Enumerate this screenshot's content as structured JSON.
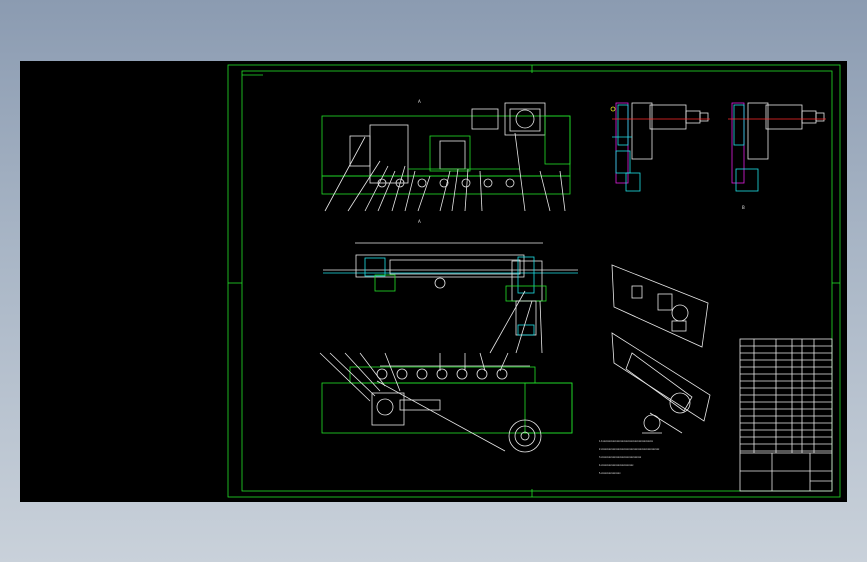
{
  "colors": {
    "background": "#000000",
    "outside": "#a9b6c6",
    "frame": "#22e02a",
    "lines": "#e8e8e8",
    "cyan": "#1ee0e8",
    "magenta": "#e020e0",
    "red": "#ff2a2a"
  },
  "drawing": {
    "notes": [
      "1.1xxxxxxxxxxxxxxxxxxxxxxxxxxxxxxxxxxxxxxx",
      "2.xxxxxxxxxxxxxxxxxxxxxxxxxxxxxxxxxxxxxxxxxxxxx",
      "3.xxxxxxxxxxxxxxxxxxxxxxxxxxxxxxx",
      "4.xxxxxxxxxxxxxxxxxxxxxxxxx",
      "5.xxxxxxxxxxxxxxx"
    ]
  }
}
